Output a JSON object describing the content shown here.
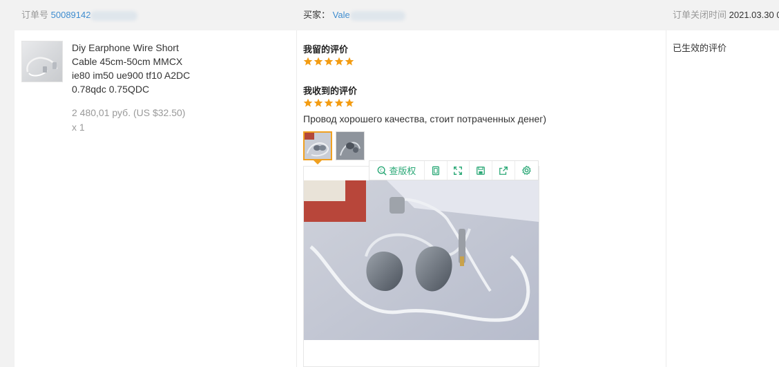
{
  "header": {
    "order_label": "订单号",
    "order_value": "50089142",
    "buyer_label": "买家：",
    "buyer_value": "Vale",
    "closed_label": "订单关闭时间",
    "closed_value": "2021.03.30 0"
  },
  "product": {
    "image_icon": "product-cable-image",
    "title": "Diy Earphone Wire Short Cable 45cm-50cm MMCX ie80 im50 ue900 tf10 A2DC 0.78qdc 0.75QDC",
    "price": "2 480,01 руб. (US $32.50)",
    "quantity": "x 1"
  },
  "feedback": {
    "my_review_title": "我留的评价",
    "my_rating": 5,
    "received_review_title": "我收到的评价",
    "received_rating": 5,
    "review_text": "Провод хорошего качества, стоит потраченных денег)",
    "star_color": "#f39c12"
  },
  "viewer_toolbar": {
    "search_label": "查版权",
    "icons": [
      "search-copyright-icon",
      "copy-icon",
      "fullscreen-icon",
      "save-icon",
      "share-icon",
      "settings-icon"
    ],
    "accent": "#2aa876"
  },
  "status": {
    "text": "已生效的评价"
  }
}
